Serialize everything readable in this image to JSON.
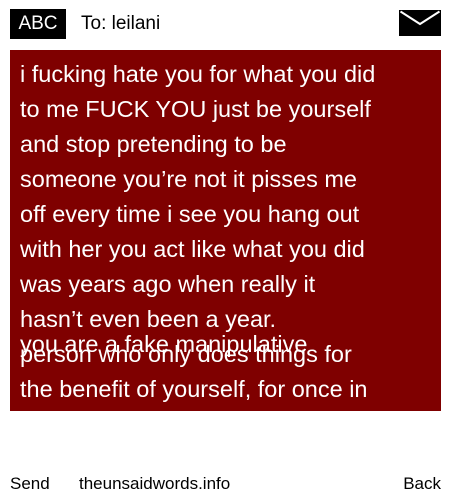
{
  "header": {
    "badge": "ABC",
    "recipient": "To: leilani",
    "icon": "envelope-icon"
  },
  "message": {
    "text_lines": "i fucking hate you for what you did\nto me FUCK YOU just be yourself\nand stop pretending to be\nsomeone you’re not it pisses me\noff every time i see you hang out\nwith her you act like what you did\nwas years ago when really it\nhasn’t even been a year.\nperson who only does things for\nthe benefit of yourself, for once in",
    "overlap_line": "you are a fake manipulative",
    "background": "#7f0000",
    "text_color": "#ffffff"
  },
  "footer": {
    "send": "Send",
    "site": "theunsaidwords.info",
    "back": "Back"
  }
}
